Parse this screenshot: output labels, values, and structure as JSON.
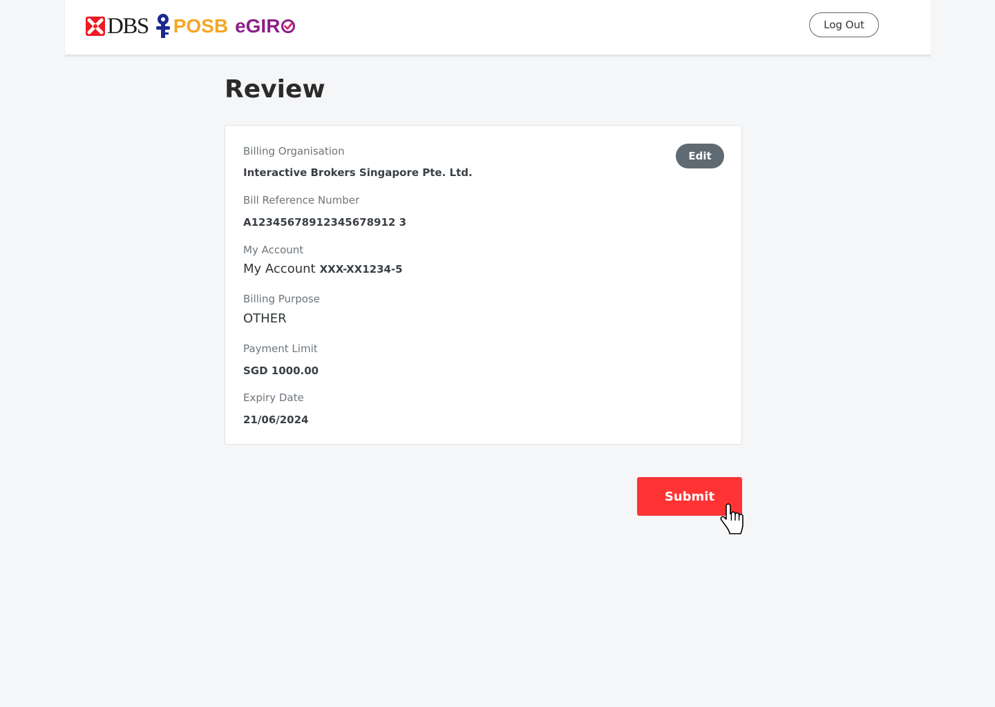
{
  "header": {
    "logo": {
      "dbs_text": "DBS",
      "posb_text": "POSB",
      "egiro_text": "eGIR"
    },
    "logout_label": "Log Out"
  },
  "main": {
    "title": "Review",
    "edit_label": "Edit",
    "fields": {
      "billing_organisation": {
        "label": "Billing Organisation",
        "value": "Interactive Brokers Singapore Pte. Ltd."
      },
      "bill_reference": {
        "label": "Bill Reference Number",
        "value": "A12345678912345678912 3"
      },
      "my_account": {
        "label": "My Account",
        "value": "My Account",
        "account_number": "XXX-XX1234-5"
      },
      "billing_purpose": {
        "label": "Billing Purpose",
        "value": "OTHER"
      },
      "payment_limit": {
        "label": "Payment Limit",
        "value": "SGD 1000.00"
      },
      "expiry_date": {
        "label": "Expiry Date",
        "value": "21/06/2024"
      }
    },
    "submit_label": "Submit"
  },
  "icons": {
    "dbs_mark": "dbs-logo-icon",
    "posb_mark": "posb-keyhole-icon",
    "egiro_check": "check-circle-icon",
    "cursor": "hand-pointer-icon"
  },
  "colors": {
    "background": "#f5f6f8",
    "submit": "#ff3333",
    "edit": "#5f6a72",
    "dbs_red": "#ed1c24",
    "posb_blue": "#1b2a8f",
    "posb_orange": "#f5a623",
    "egiro_purple": "#8b1f87"
  }
}
